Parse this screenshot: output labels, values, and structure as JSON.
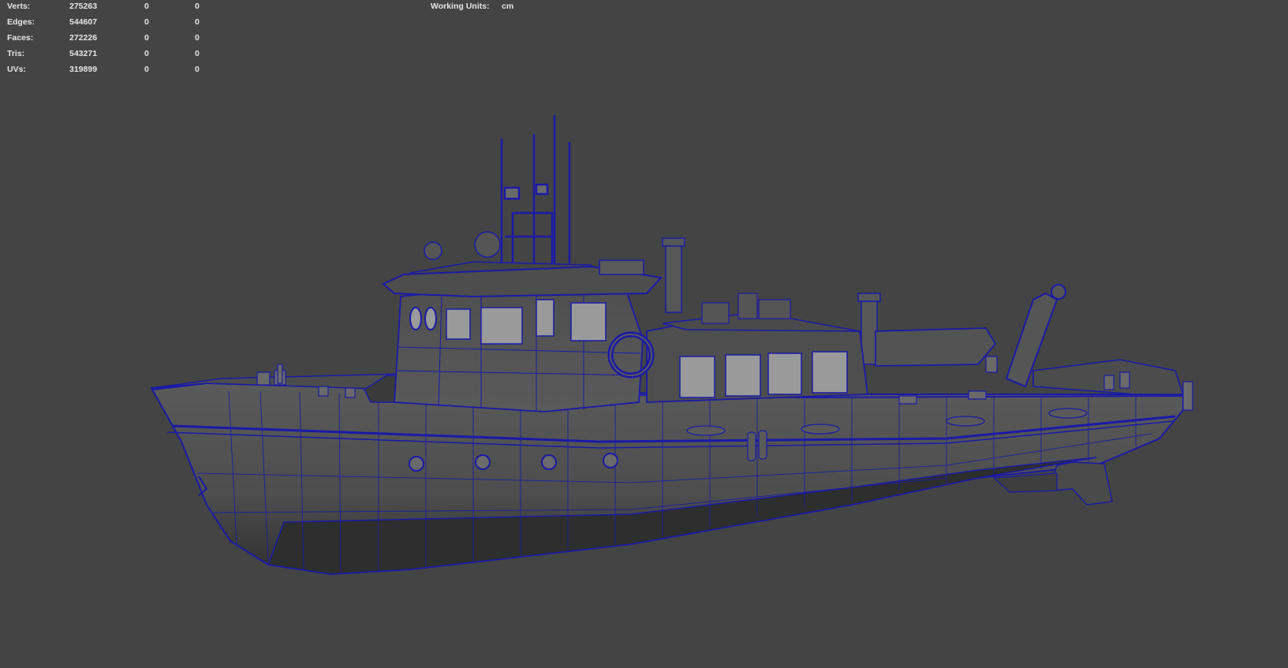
{
  "hud": {
    "rows": [
      {
        "label": "Verts:",
        "v1": "275263",
        "v2": "0",
        "v3": "0"
      },
      {
        "label": "Edges:",
        "v1": "544607",
        "v2": "0",
        "v3": "0"
      },
      {
        "label": "Faces:",
        "v1": "272226",
        "v2": "0",
        "v3": "0"
      },
      {
        "label": "Tris:",
        "v1": "543271",
        "v2": "0",
        "v3": "0"
      },
      {
        "label": "UVs:",
        "v1": "319899",
        "v2": "0",
        "v3": "0"
      }
    ],
    "working_units_label": "Working Units:",
    "working_units_value": "cm"
  },
  "colors": {
    "background": "#444444",
    "wireframe": "#1a1aa8",
    "hull": "#555555",
    "windows": "#9a9a9a"
  },
  "model": {
    "icon": "boat-wireframe-model"
  }
}
